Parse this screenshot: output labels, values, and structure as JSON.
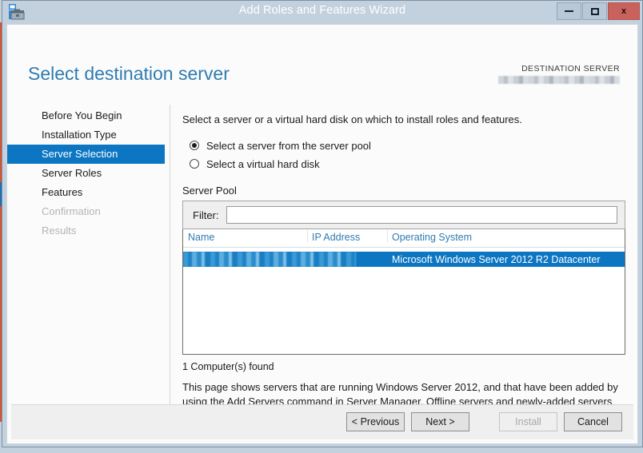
{
  "window": {
    "title": "Add Roles and Features Wizard",
    "icon": "server-manager-icon",
    "minimize_label": "Minimize",
    "maximize_label": "Maximize",
    "close_label": "x",
    "accent_color": "#0c76c2",
    "titlebar_color": "#c3d1de",
    "close_button_color": "#c9625c"
  },
  "header": {
    "page_title": "Select destination server",
    "destination_label": "DESTINATION SERVER",
    "destination_value": ""
  },
  "sidebar": {
    "items": [
      {
        "label": "Before You Begin",
        "state": "normal"
      },
      {
        "label": "Installation Type",
        "state": "normal"
      },
      {
        "label": "Server Selection",
        "state": "active"
      },
      {
        "label": "Server Roles",
        "state": "normal"
      },
      {
        "label": "Features",
        "state": "normal"
      },
      {
        "label": "Confirmation",
        "state": "disabled"
      },
      {
        "label": "Results",
        "state": "disabled"
      }
    ]
  },
  "main": {
    "intro_text": "Select a server or a virtual hard disk on which to install roles and features.",
    "radio_options": [
      {
        "label": "Select a server from the server pool",
        "checked": true
      },
      {
        "label": "Select a virtual hard disk",
        "checked": false
      }
    ],
    "server_pool_label": "Server Pool",
    "filter": {
      "label": "Filter:",
      "value": "",
      "placeholder": ""
    },
    "table": {
      "columns": [
        "Name",
        "IP Address",
        "Operating System"
      ],
      "rows": [
        {
          "name": "",
          "ip_address": "",
          "operating_system": "Microsoft Windows Server 2012 R2 Datacenter",
          "selected": true
        }
      ]
    },
    "found_text": "1 Computer(s) found",
    "help_text": "This page shows servers that are running Windows Server 2012, and that have been added by using the Add Servers command in Server Manager. Offline servers and newly-added servers from which data collection is still incomplete are not shown."
  },
  "footer": {
    "previous_label": "< Previous",
    "next_label": "Next >",
    "install_label": "Install",
    "install_enabled": false,
    "cancel_label": "Cancel"
  }
}
